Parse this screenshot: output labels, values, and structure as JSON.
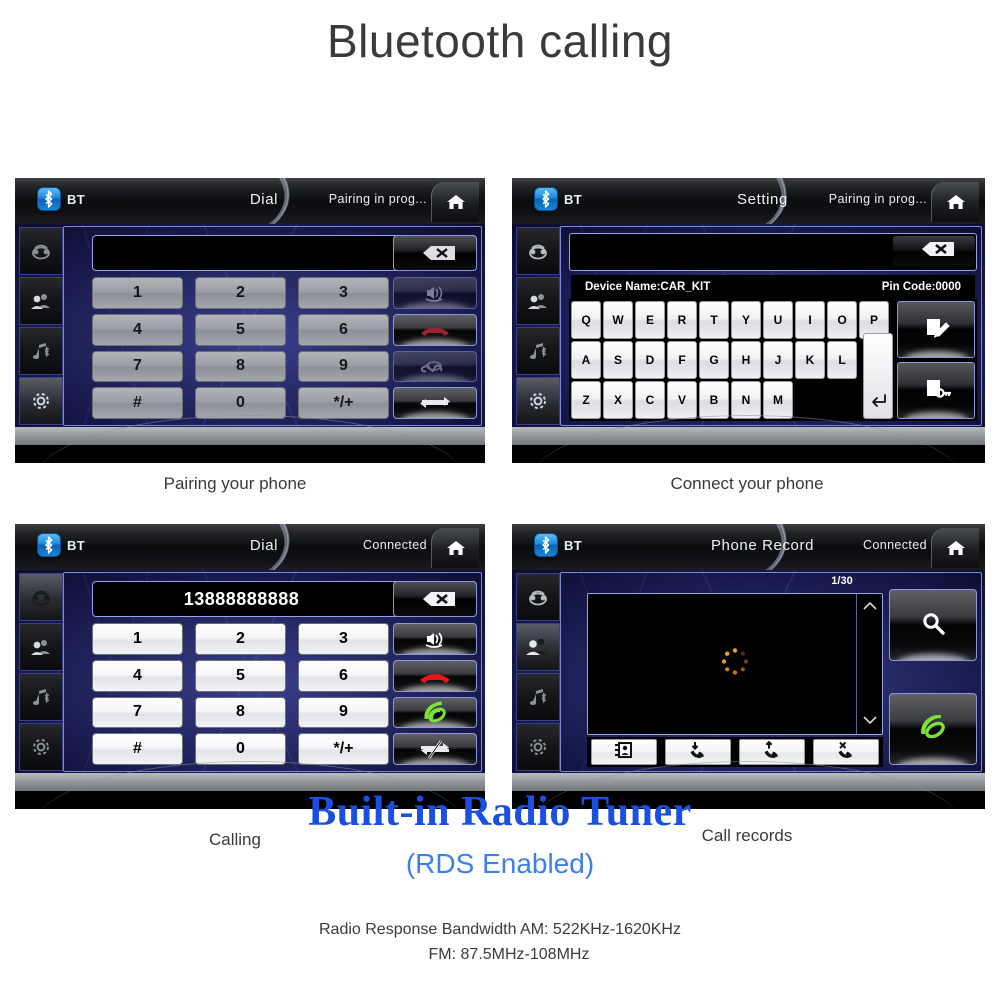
{
  "page": {
    "title": "Bluetooth calling"
  },
  "panels": [
    {
      "id": "pairing",
      "bt_label": "BT",
      "title": "Dial",
      "status": "Pairing in prog...",
      "caption": "Pairing your phone",
      "dial_number": "",
      "keys": [
        "1",
        "2",
        "3",
        "4",
        "5",
        "6",
        "7",
        "8",
        "9",
        "#",
        "0",
        "*/+"
      ],
      "keys_state": "dim",
      "actions": [
        "speaker-icon",
        "hangup-icon",
        "call-icon",
        "transfer-icon"
      ],
      "rail": [
        "phone-icon",
        "contacts-icon",
        "bt-audio-icon",
        "settings-icon"
      ],
      "rail_active": 3
    },
    {
      "id": "connect",
      "bt_label": "BT",
      "title": "Setting",
      "status": "Pairing in prog...",
      "caption": "Connect your phone",
      "device_name": "Device Name:CAR_KIT",
      "pin_code": "Pin Code:0000",
      "keyboard": {
        "row1": [
          "Q",
          "W",
          "E",
          "R",
          "T",
          "Y",
          "U",
          "I",
          "O",
          "P"
        ],
        "row2": [
          "A",
          "S",
          "D",
          "F",
          "G",
          "H",
          "J",
          "K",
          "L"
        ],
        "row3": [
          "Z",
          "X",
          "C",
          "V",
          "B",
          "N",
          "M"
        ],
        "enter": "enter-icon"
      },
      "side_buttons": [
        "edit-name-icon",
        "edit-pin-icon"
      ],
      "rail": [
        "phone-icon",
        "contacts-icon",
        "bt-audio-icon",
        "settings-icon"
      ],
      "rail_active": 3
    },
    {
      "id": "calling",
      "bt_label": "BT",
      "title": "Dial",
      "status": "Connected",
      "caption": "Calling",
      "dial_number": "13888888888",
      "keys": [
        "1",
        "2",
        "3",
        "4",
        "5",
        "6",
        "7",
        "8",
        "9",
        "#",
        "0",
        "*/+"
      ],
      "keys_state": "bright",
      "actions": [
        "speaker-icon",
        "hangup-icon",
        "call-icon",
        "transfer-mute-icon"
      ],
      "rail": [
        "phone-icon",
        "contacts-icon",
        "bt-audio-icon",
        "settings-icon"
      ],
      "rail_active": 0
    },
    {
      "id": "records",
      "bt_label": "BT",
      "title": "Phone Record",
      "status": "Connected",
      "caption": "Call records",
      "page_indicator": "1/30",
      "list_tabs": [
        "phonebook-icon",
        "incoming-call-icon",
        "outgoing-call-icon",
        "missed-call-icon"
      ],
      "side_buttons": [
        "search-icon",
        "call-icon"
      ],
      "rail": [
        "phone-icon",
        "contacts-icon",
        "bt-audio-icon",
        "settings-icon"
      ],
      "rail_active": 1
    }
  ],
  "footer": {
    "radio_title": "Built-in Radio Tuner",
    "radio_subtitle": "(RDS Enabled)",
    "spec_line1": "Radio Response Bandwidth AM: 522KHz-1620KHz",
    "spec_line2": "FM: 87.5MHz-108MHz"
  },
  "colors": {
    "radio_title": "#1b4fe0",
    "radio_subtitle": "#3f7fe8",
    "bluetooth_blue": "#1f8fe0",
    "call_green": "#7ede3a",
    "hangup_red": "#e02020",
    "spinner_orange": "#f2a01e"
  }
}
